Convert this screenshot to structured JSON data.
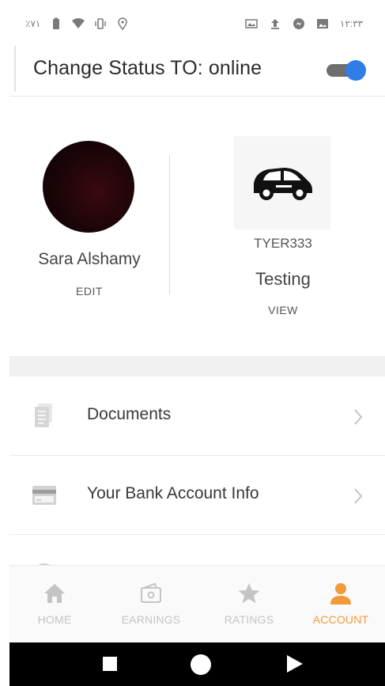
{
  "status_bar": {
    "left_text": "٪٧١",
    "time": "١٢:٣٣"
  },
  "header": {
    "title": "Change Status TO: online",
    "toggle_on": true,
    "toggle_color": "#2f7de6"
  },
  "profile": {
    "name": "Sara Alshamy",
    "edit_label": "EDIT"
  },
  "vehicle": {
    "plate": "TYER333",
    "model": "Testing",
    "view_label": "VIEW",
    "icon": "car-icon"
  },
  "menu": {
    "items": [
      {
        "label": "Documents",
        "icon": "document-icon"
      },
      {
        "label": "Your Bank Account Info",
        "icon": "credit-card-icon"
      },
      {
        "label": "",
        "icon": "info-icon"
      }
    ]
  },
  "bottom_nav": {
    "active_color": "#f29a38",
    "inactive_color": "#c4c4c4",
    "items": [
      {
        "label": "HOME",
        "icon": "home-icon",
        "active": false
      },
      {
        "label": "EARNINGS",
        "icon": "wallet-icon",
        "active": false
      },
      {
        "label": "RATINGS",
        "icon": "star-icon",
        "active": false
      },
      {
        "label": "ACCOUNT",
        "icon": "person-icon",
        "active": true
      }
    ]
  },
  "system_nav": {
    "buttons": [
      "recents-icon",
      "home-circle-icon",
      "back-icon"
    ]
  }
}
